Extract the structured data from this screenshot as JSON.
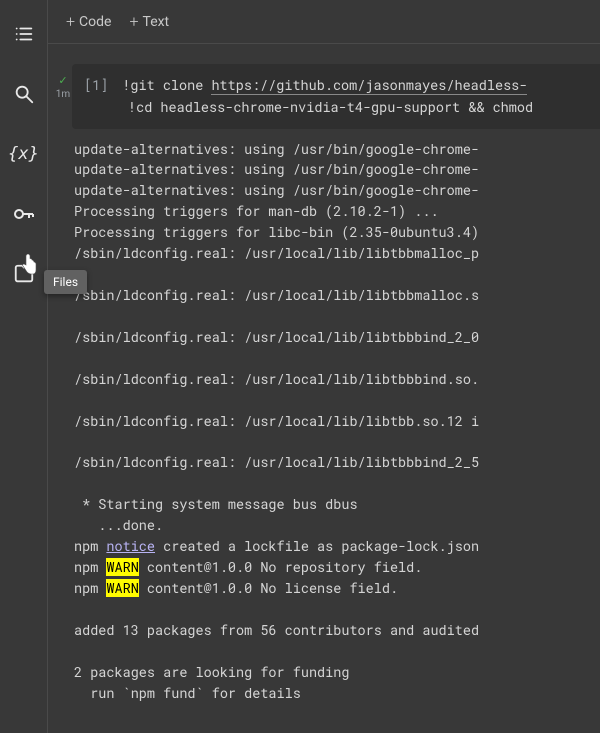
{
  "sidebar": {
    "items": [
      {
        "name": "toc-icon"
      },
      {
        "name": "search-icon"
      },
      {
        "name": "variables-icon"
      },
      {
        "name": "secrets-icon"
      },
      {
        "name": "files-icon"
      }
    ],
    "tooltip": "Files"
  },
  "toolbar": {
    "code_label": "Code",
    "text_label": "Text"
  },
  "cell": {
    "prompt_number": "[1]",
    "exec_time": "1m",
    "code_lines": {
      "l1_bang": "!",
      "l1_cmd": "git clone ",
      "l1_url": "https://github.com/jasonmayes/headless-",
      "l2_bang": "!",
      "l2_cmd": "cd headless-chrome-nvidia-t4-gpu-support && chmod"
    },
    "output_lines": [
      "update-alternatives: using /usr/bin/google-chrome-",
      "update-alternatives: using /usr/bin/google-chrome-",
      "update-alternatives: using /usr/bin/google-chrome-",
      "Processing triggers for man-db (2.10.2-1) ...",
      "Processing triggers for libc-bin (2.35-0ubuntu3.4)",
      "/sbin/ldconfig.real: /usr/local/lib/libtbbmalloc_p",
      "",
      "/sbin/ldconfig.real: /usr/local/lib/libtbbmalloc.s",
      "",
      "/sbin/ldconfig.real: /usr/local/lib/libtbbbind_2_0",
      "",
      "/sbin/ldconfig.real: /usr/local/lib/libtbbbind.so.",
      "",
      "/sbin/ldconfig.real: /usr/local/lib/libtbb.so.12 i",
      "",
      "/sbin/ldconfig.real: /usr/local/lib/libtbbbind_2_5",
      "",
      " * Starting system message bus dbus",
      "   ...done."
    ],
    "npm_notice_prefix": "npm ",
    "npm_notice_word": "notice",
    "npm_notice_rest": " created a lockfile as package-lock.json",
    "npm_warn1_prefix": "npm ",
    "npm_warn1_tag": "WARN",
    "npm_warn1_rest": " content@1.0.0 No repository field.",
    "npm_warn2_prefix": "npm ",
    "npm_warn2_tag": "WARN",
    "npm_warn2_rest": " content@1.0.0 No license field.",
    "tail": [
      "",
      "added 13 packages from 56 contributors and audited",
      "",
      "2 packages are looking for funding",
      "  run `npm fund` for details"
    ]
  }
}
